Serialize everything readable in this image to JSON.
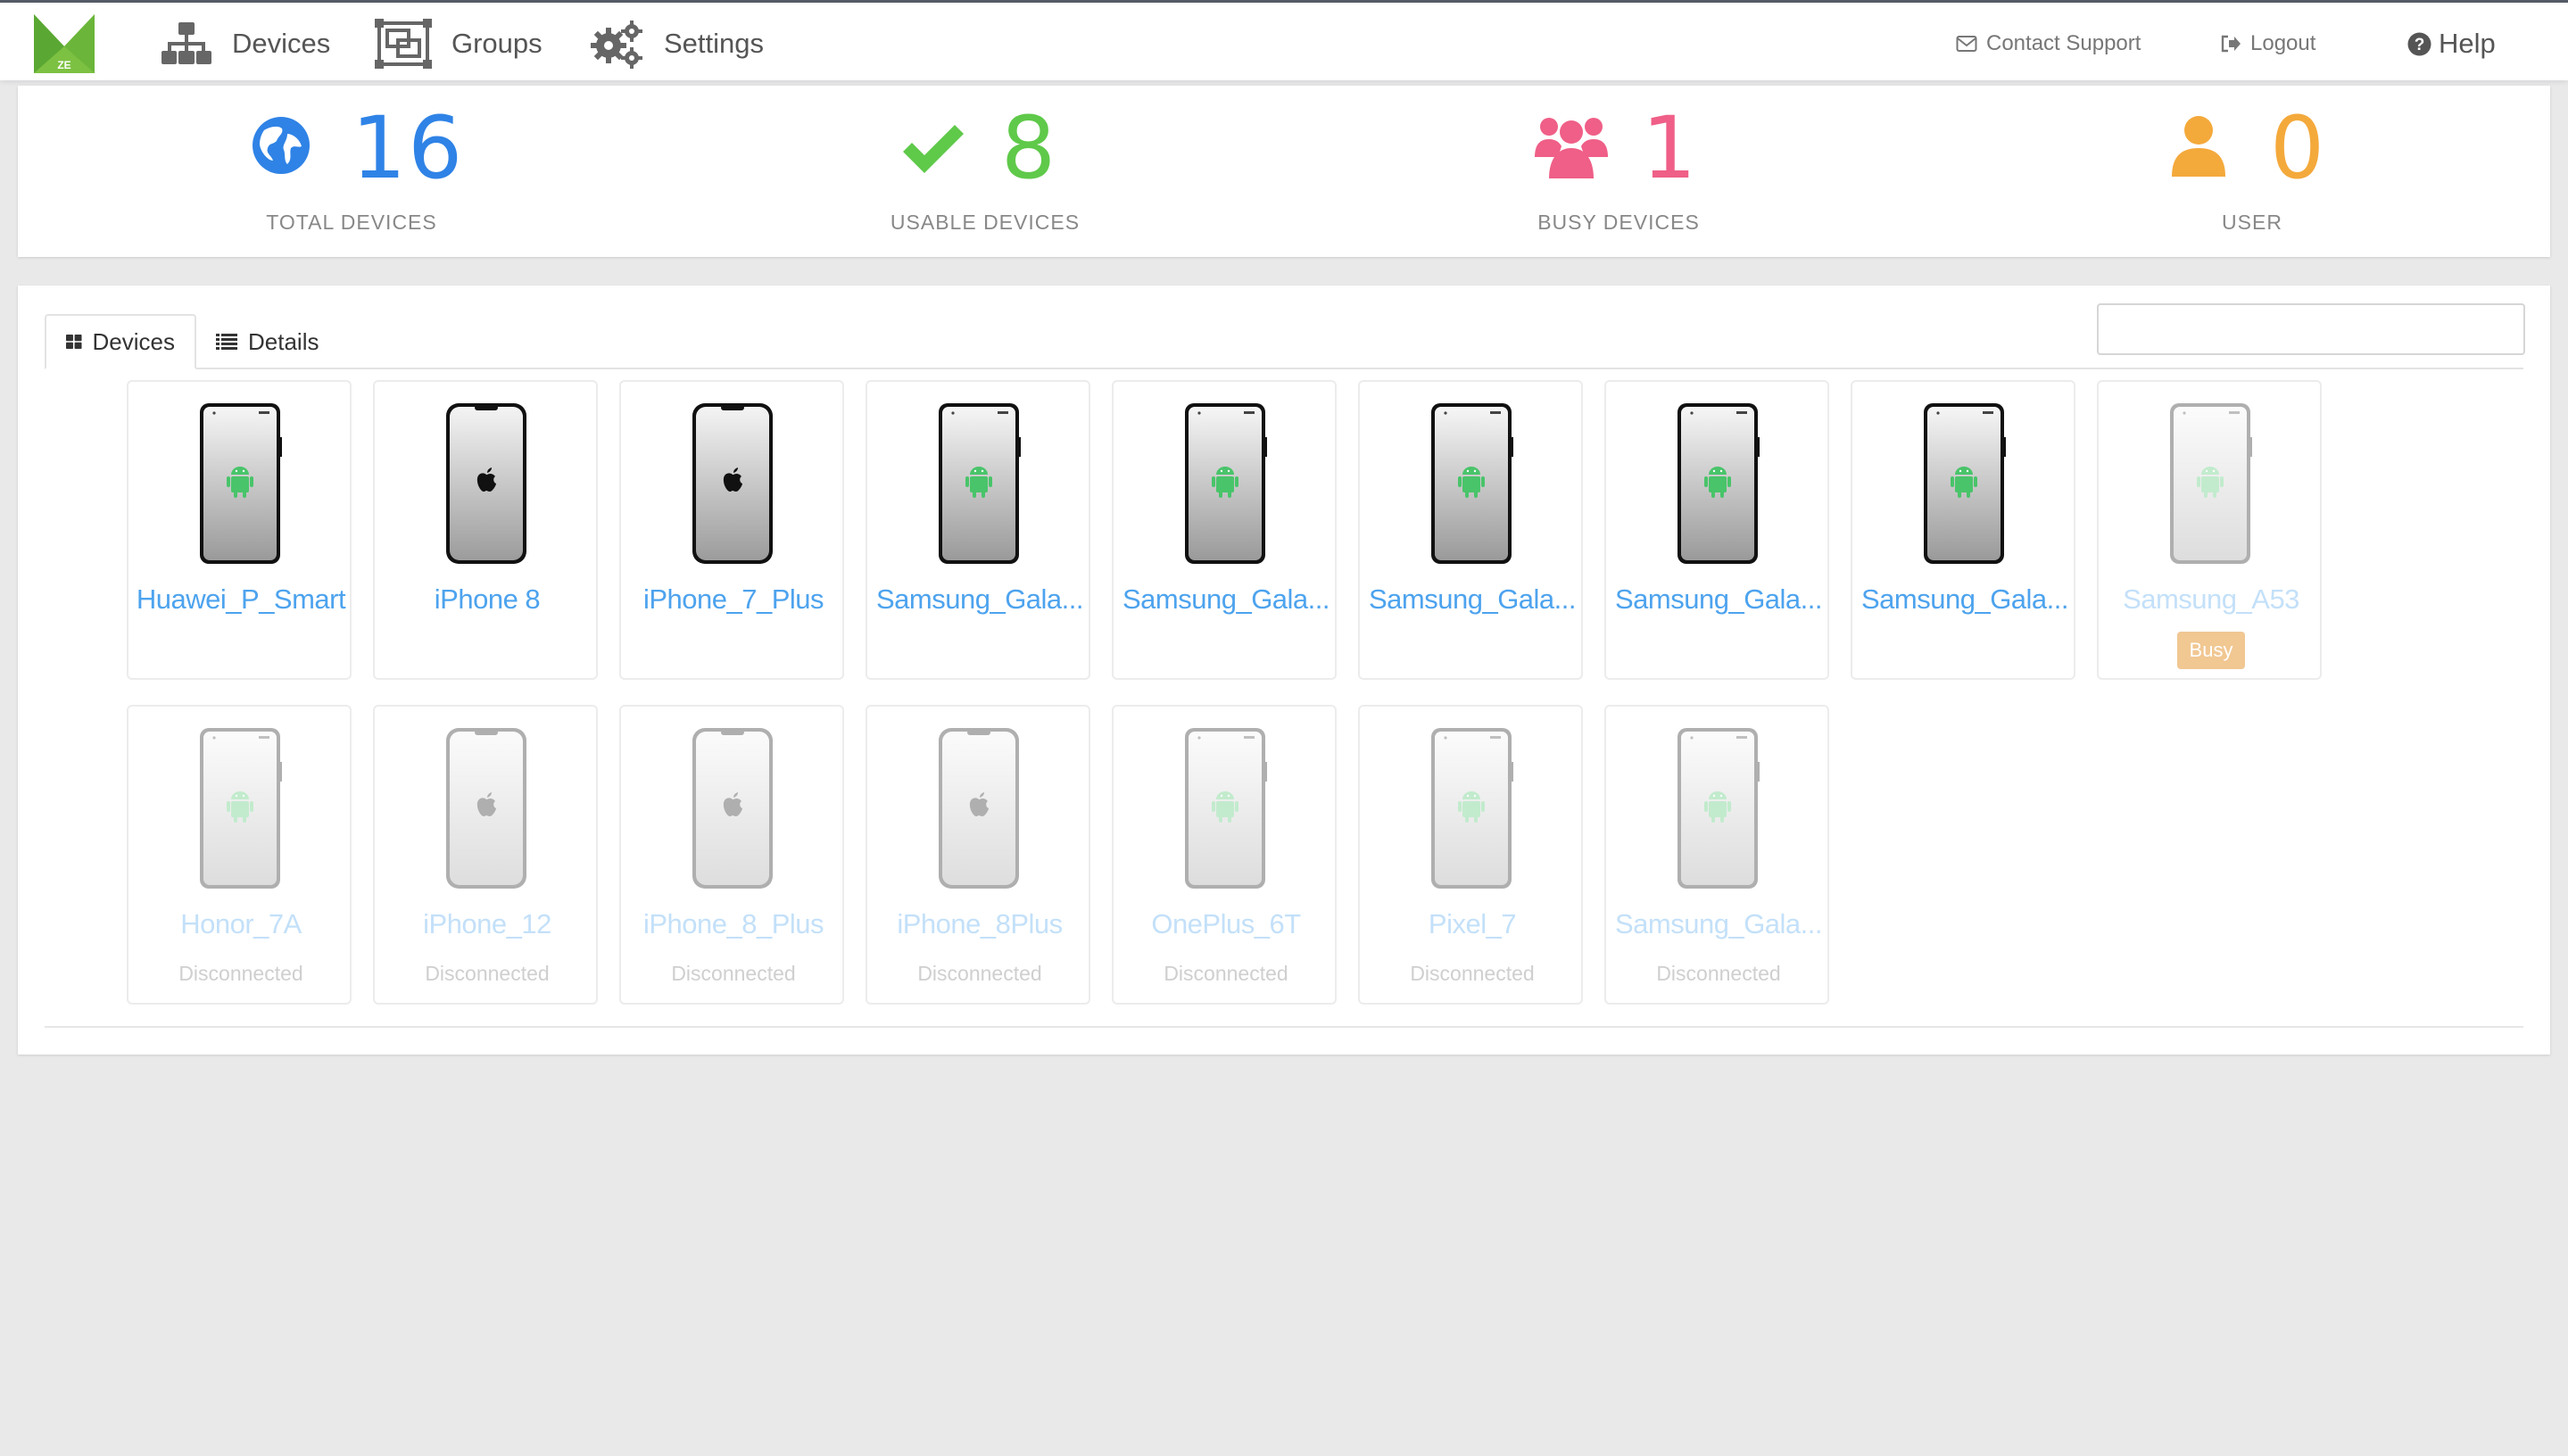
{
  "app": {
    "logo_text": "ZE",
    "brand_color": "#7dc142"
  },
  "nav": {
    "devices_label": "Devices",
    "groups_label": "Groups",
    "settings_label": "Settings",
    "contact_label": "Contact Support",
    "logout_label": "Logout",
    "help_label": "Help"
  },
  "stats": [
    {
      "value": "16",
      "label": "TOTAL DEVICES",
      "icon": "globe-icon",
      "color": "#2f83e6"
    },
    {
      "value": "8",
      "label": "USABLE DEVICES",
      "icon": "checkmark-icon",
      "color": "#5fc94a"
    },
    {
      "value": "1",
      "label": "BUSY DEVICES",
      "icon": "users-icon",
      "color": "#ef5f87"
    },
    {
      "value": "0",
      "label": "USER",
      "icon": "user-icon",
      "color": "#f4a93b"
    }
  ],
  "tabs": {
    "devices_label": "Devices",
    "details_label": "Details"
  },
  "search": {
    "value": "",
    "placeholder": ""
  },
  "devices": [
    {
      "name": "Huawei_P_Smart",
      "os": "android",
      "state": "usable",
      "status": ""
    },
    {
      "name": "iPhone 8",
      "os": "ios",
      "state": "usable",
      "status": ""
    },
    {
      "name": "iPhone_7_Plus",
      "os": "ios",
      "state": "usable",
      "status": ""
    },
    {
      "name": "Samsung_Gala...",
      "os": "android",
      "state": "usable",
      "status": ""
    },
    {
      "name": "Samsung_Gala...",
      "os": "android",
      "state": "usable",
      "status": ""
    },
    {
      "name": "Samsung_Gala...",
      "os": "android",
      "state": "usable",
      "status": ""
    },
    {
      "name": "Samsung_Gala...",
      "os": "android",
      "state": "usable",
      "status": ""
    },
    {
      "name": "Samsung_Gala...",
      "os": "android",
      "state": "usable",
      "status": ""
    },
    {
      "name": "Samsung_A53",
      "os": "android",
      "state": "busy",
      "status": "Busy"
    },
    {
      "name": "Honor_7A",
      "os": "android",
      "state": "disconnected",
      "status": "Disconnected"
    },
    {
      "name": "iPhone_12",
      "os": "ios",
      "state": "disconnected",
      "status": "Disconnected"
    },
    {
      "name": "iPhone_8_Plus",
      "os": "ios",
      "state": "disconnected",
      "status": "Disconnected"
    },
    {
      "name": "iPhone_8Plus",
      "os": "ios",
      "state": "disconnected",
      "status": "Disconnected"
    },
    {
      "name": "OnePlus_6T",
      "os": "android",
      "state": "disconnected",
      "status": "Disconnected"
    },
    {
      "name": "Pixel_7",
      "os": "android",
      "state": "disconnected",
      "status": "Disconnected"
    },
    {
      "name": "Samsung_Gala...",
      "os": "android",
      "state": "disconnected",
      "status": "Disconnected"
    }
  ]
}
